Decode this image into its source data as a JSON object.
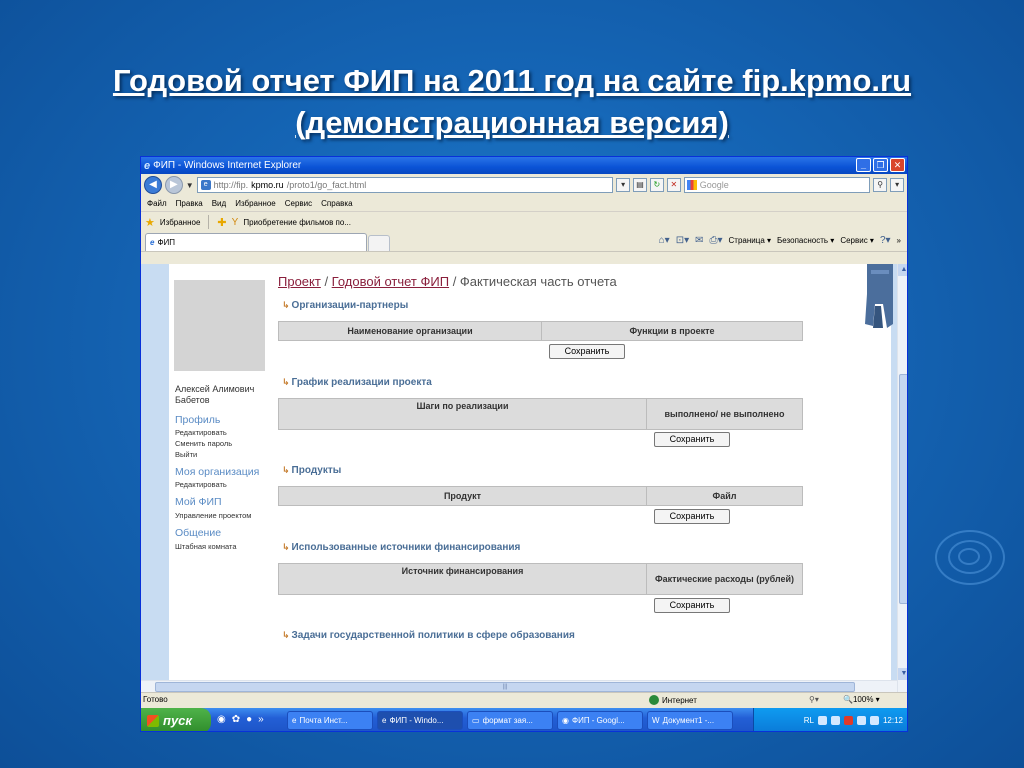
{
  "slide": {
    "title_line1": " Годовой отчет ФИП на 2011 год на сайте fip.kpmo.ru",
    "title_line2": " (демонстрационная версия)"
  },
  "window": {
    "title": "ФИП - Windows Internet Explorer",
    "address_prefix": "http://fip.",
    "address_host": "kpmo.ru",
    "address_path": "/proto1/go_fact.html",
    "search_placeholder": "Google",
    "menu": [
      "Файл",
      "Правка",
      "Вид",
      "Избранное",
      "Сервис",
      "Справка"
    ],
    "favorites_label": "Избранное",
    "favorites_link": "Приобретение фильмов по...",
    "tab_label": "ФИП",
    "cmd": [
      "Страница ▾",
      "Безопасность ▾",
      "Сервис ▾"
    ]
  },
  "sidebar": {
    "user_name": "Алексей Алимович Бабетов",
    "profile": "Профиль",
    "profile_edit": "Редактировать",
    "profile_password": "Сменить пароль",
    "profile_logout": "Выйти",
    "org": "Моя организация",
    "org_edit": "Редактировать",
    "fip": "Мой ФИП",
    "fip_manage": "Управление проектом",
    "comm": "Общение",
    "comm_room": "Штабная комната"
  },
  "main": {
    "bc_project": "Проект",
    "bc_sep": " / ",
    "bc_report": "Годовой отчет ФИП",
    "bc_current": " / Фактическая часть отчета",
    "save": "Сохранить",
    "sections": [
      {
        "title": "Организации-партнеры",
        "cols": [
          "Наименование организации",
          "Функции в проекте"
        ]
      },
      {
        "title": "График реализации проекта",
        "cols": [
          "Шаги по реализации",
          "выполнено/ не выполнено"
        ]
      },
      {
        "title": "Продукты",
        "cols": [
          "Продукт",
          "Файл"
        ]
      },
      {
        "title": "Использованные источники финансирования",
        "cols": [
          "Источник финансирования",
          "Фактические расходы (рублей)"
        ]
      },
      {
        "title": "Задачи государственной политики в сфере образования"
      }
    ]
  },
  "status": {
    "left": "Готово",
    "zone": "Интернет",
    "zoom": "100%"
  },
  "taskbar": {
    "start": "пуск",
    "tasks": [
      "Почта Инст...",
      "ФИП - Windo...",
      "формат зая...",
      "ФИП - Googl...",
      "Документ1 -..."
    ],
    "tray_lang": "RL",
    "clock": "12:12"
  }
}
